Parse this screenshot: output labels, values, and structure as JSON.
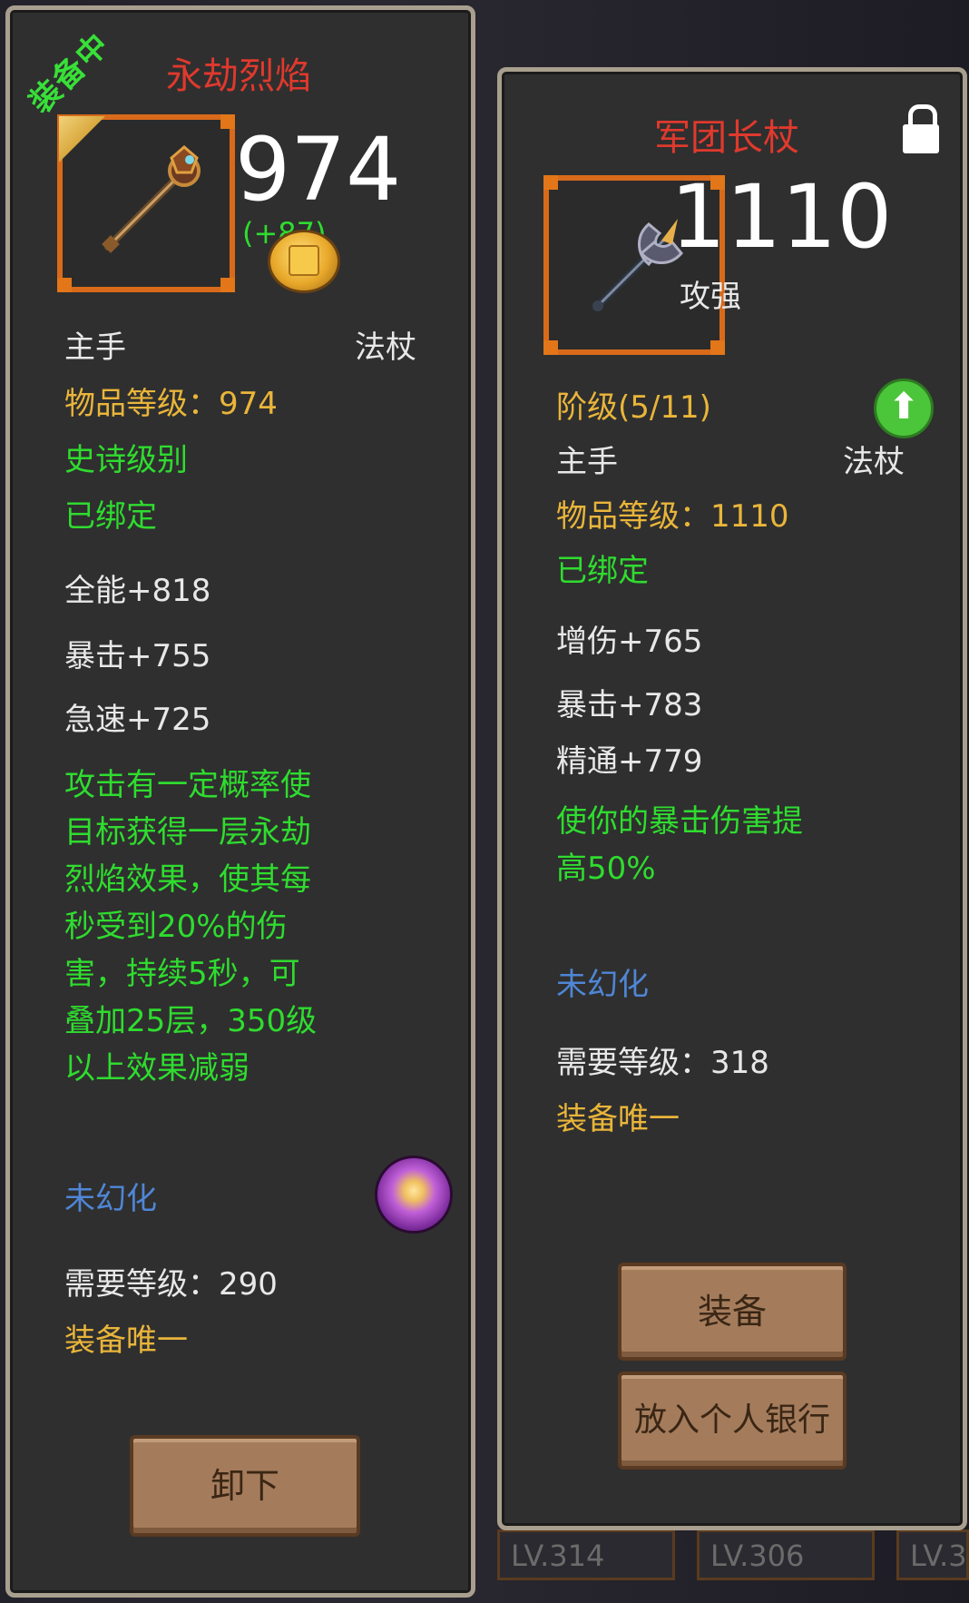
{
  "background": {
    "level_tags": [
      "LV.314",
      "LV.306",
      "LV.3"
    ]
  },
  "left_panel": {
    "equipped_tag": "装备中",
    "title": "永劫烈焰",
    "item_level_big": "974",
    "compare_text": "(+87)",
    "slot": "主手",
    "weapon_type": "法杖",
    "item_level_line": "物品等级：974",
    "quality": "史诗级别",
    "bound": "已绑定",
    "stats": [
      "全能+818",
      "暴击+755",
      "急速+725"
    ],
    "effect_lines": [
      "攻击有一定概率使",
      "目标获得一层永劫",
      "烈焰效果，使其每",
      "秒受到20%的伤",
      "害，持续5秒，可",
      "叠加25层，350级",
      "以上效果减弱"
    ],
    "transmog": "未幻化",
    "required_level": "需要等级：290",
    "unique": "装备唯一",
    "unequip_button": "卸下"
  },
  "right_panel": {
    "title": "军团长杖",
    "item_level_big": "1110",
    "stat_label": "攻强",
    "rank": "阶级(5/11)",
    "slot": "主手",
    "weapon_type": "法杖",
    "item_level_line": "物品等级：1110",
    "bound": "已绑定",
    "stats": [
      "增伤+765",
      "暴击+783",
      "精通+779"
    ],
    "effect_lines": [
      "使你的暴击伤害提",
      "高50%"
    ],
    "transmog": "未幻化",
    "required_level": "需要等级：318",
    "unique": "装备唯一",
    "equip_button": "装备",
    "bank_button": "放入个人银行"
  },
  "colors": {
    "title_red": "#e0392d",
    "quality_green": "#2fdc2f",
    "yellow": "#e9b53a",
    "blue": "#4f86d6",
    "icon_border_orange": "#d86a1a"
  },
  "icons": {
    "left_item": "scepter-staff-icon",
    "right_item": "axe-staff-icon",
    "coin": "gold-coin-icon",
    "orb": "purple-orb-icon",
    "upgrade": "green-up-arrow-icon",
    "lock": "lock-icon"
  }
}
